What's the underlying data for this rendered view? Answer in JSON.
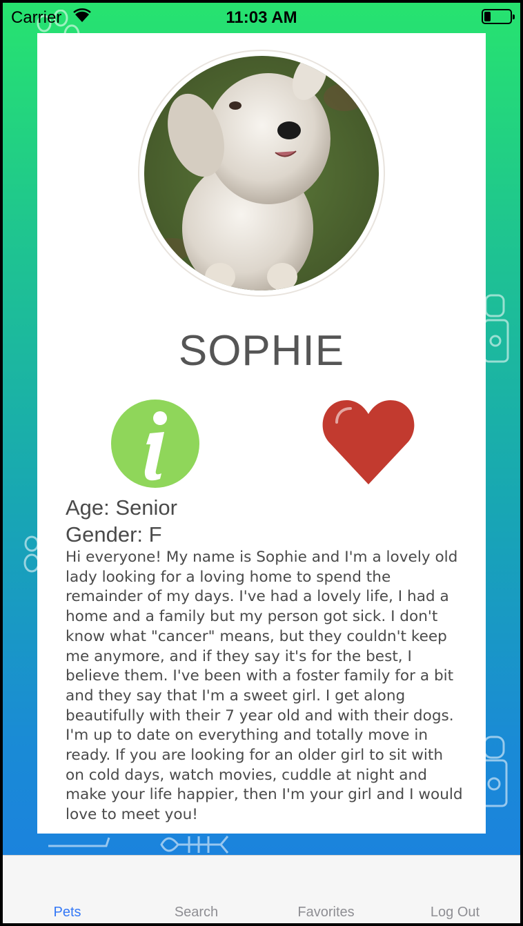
{
  "status_bar": {
    "carrier": "Carrier",
    "time": "11:03 AM",
    "wifi_icon": "wifi-icon",
    "battery_icon": "battery-low-icon"
  },
  "pet": {
    "name": "SOPHIE",
    "age": "Age: Senior",
    "gender": "Gender: F",
    "description": "Hi everyone! My name is Sophie and I'm a lovely old lady looking for a loving home to spend the remainder of my days. I've had a lovely life, I had a home and a family but my person got sick. I don't know what \"cancer\" means, but they couldn't keep me anymore, and if they say it's for the best, I believe them. I've been with a foster family for a bit and they say that I'm a sweet girl. I get along beautifully with their 7 year old and with their dogs. I'm up to date on everything and totally move in ready. If you are looking for an older girl to sit with on cold days, watch movies, cuddle at night and make your life happier, then I'm your girl and I would love to meet you!"
  },
  "actions": {
    "info_icon": "info-icon",
    "favorite_icon": "heart-icon"
  },
  "tabs": [
    {
      "label": "Pets",
      "active": true
    },
    {
      "label": "Search",
      "active": false
    },
    {
      "label": "Favorites",
      "active": false
    },
    {
      "label": "Log Out",
      "active": false
    }
  ],
  "colors": {
    "gradient_top": "#27e36f",
    "gradient_bottom": "#1c7ee2",
    "tab_active": "#3478f6",
    "tab_inactive": "#8e8e93",
    "info_green": "#8fd65a",
    "heart_red": "#c23a2f"
  }
}
